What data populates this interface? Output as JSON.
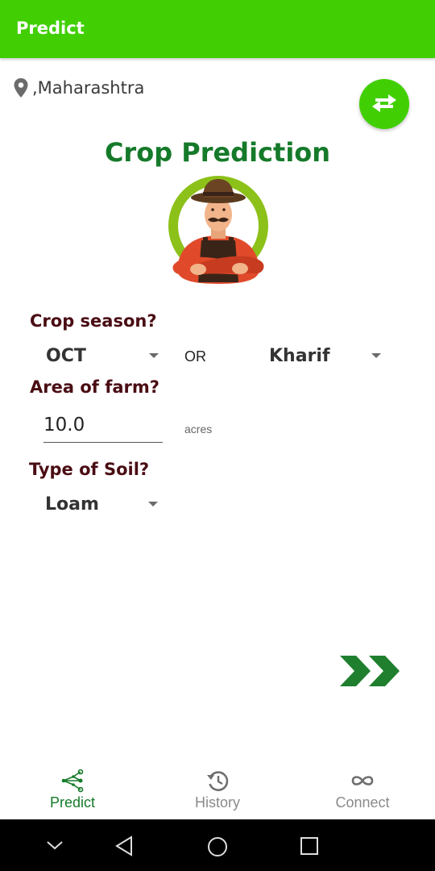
{
  "appbar": {
    "title": "Predict"
  },
  "location": {
    "text": ",Maharashtra",
    "icon": "location-pin-icon"
  },
  "swap": {
    "icon": "swap-arrows-icon"
  },
  "header": {
    "title": "Crop Prediction"
  },
  "form": {
    "season_label": "Crop season?",
    "month_value": "OCT",
    "or_text": "OR",
    "season_value": "Kharif",
    "area_label": "Area of farm?",
    "area_value": "10.0",
    "area_unit": "acres",
    "soil_label": "Type of Soil?",
    "soil_value": "Loam"
  },
  "next": {
    "icon": "double-chevron-right-icon"
  },
  "bottom_nav": {
    "items": [
      {
        "label": "Predict",
        "icon": "share-nodes-icon",
        "active": true
      },
      {
        "label": "History",
        "icon": "history-icon",
        "active": false
      },
      {
        "label": "Connect",
        "icon": "infinity-icon",
        "active": false
      }
    ]
  },
  "colors": {
    "primary": "#41cf04",
    "title_green": "#157a2a",
    "label_maroon": "#4a0d14",
    "nav_active": "#157a2a",
    "nav_inactive": "#8a8a8a"
  }
}
